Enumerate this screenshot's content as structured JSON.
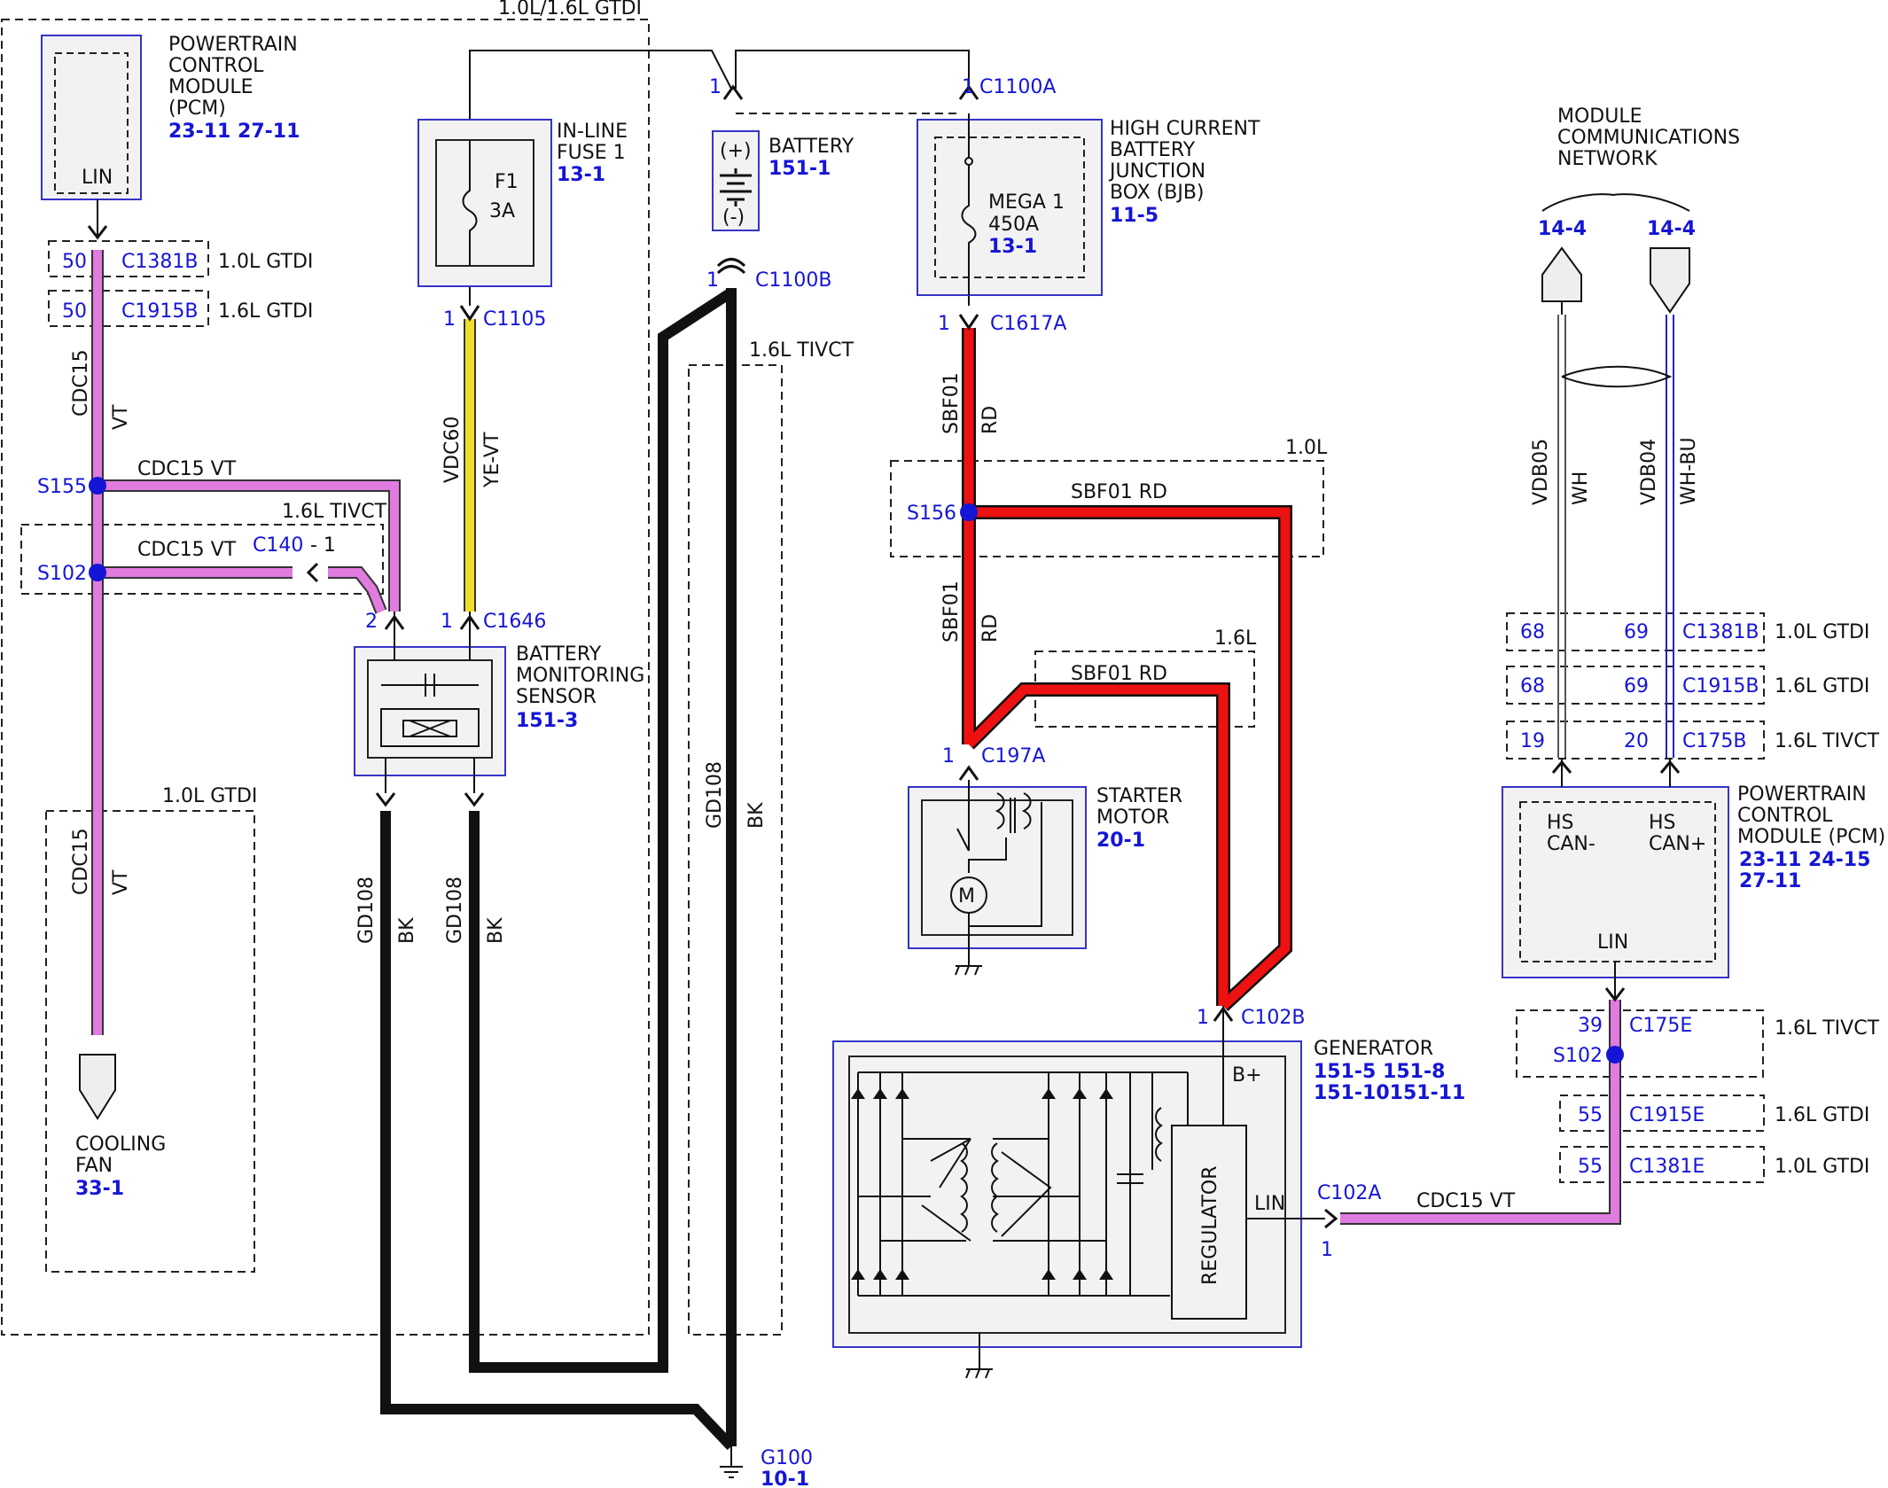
{
  "labels": {
    "gtdi_both": "1.0L/1.6L GTDI",
    "tivct": "1.6L TIVCT",
    "gtdi10": "1.0L GTDI",
    "gtdi16": "1.6L GTDI",
    "l10": "1.0L",
    "l16": "1.6L"
  },
  "pcm": {
    "l1": "POWERTRAIN",
    "l2": "CONTROL",
    "l3": "MODULE",
    "l4": "(PCM)",
    "ref": "23-11 27-11",
    "pin": "LIN"
  },
  "fuse": {
    "l1": "IN-LINE",
    "l2": "FUSE 1",
    "ref": "13-1",
    "name": "F1",
    "rating": "3A"
  },
  "battery": {
    "name": "BATTERY",
    "ref": "151-1",
    "plus": "(+)",
    "minus": "(-)"
  },
  "bjb": {
    "l1": "HIGH CURRENT",
    "l2": "BATTERY",
    "l3": "JUNCTION",
    "l4": "BOX (BJB)",
    "ref": "11-5",
    "fuse": "MEGA 1",
    "rating": "450A",
    "fuse_ref": "13-1"
  },
  "network": {
    "l1": "MODULE",
    "l2": "COMMUNICATIONS",
    "l3": "NETWORK",
    "ref_a": "14-4",
    "ref_b": "14-4"
  },
  "bms": {
    "l1": "BATTERY",
    "l2": "MONITORING",
    "l3": "SENSOR",
    "ref": "151-3"
  },
  "starter": {
    "l1": "STARTER",
    "l2": "MOTOR",
    "ref": "20-1"
  },
  "fan": {
    "l1": "COOLING",
    "l2": "FAN",
    "ref": "33-1"
  },
  "pcm2": {
    "l1": "POWERTRAIN",
    "l2": "CONTROL",
    "l3": "MODULE (PCM)",
    "ref1": "23-11 24-15",
    "ref2": "27-11",
    "can_lo1": "HS",
    "can_lo2": "CAN-",
    "can_hi1": "HS",
    "can_hi2": "CAN+",
    "pin": "LIN"
  },
  "generator": {
    "name": "GENERATOR",
    "ref1": "151-5 151-8",
    "ref2": "151-10151-11",
    "bplus": "B+",
    "regulator": "REGULATOR",
    "lin": "LIN"
  },
  "ground": {
    "name": "G100",
    "ref": "10-1"
  },
  "connectors": {
    "c1381b": "C1381B",
    "c1915b": "C1915B",
    "c1105": "C1105",
    "c1100a": "C1100A",
    "c1100b": "C1100B",
    "c1617a": "C1617A",
    "c1646": "C1646",
    "c140": "C140",
    "c197a": "C197A",
    "c102b": "C102B",
    "c102a": "C102A",
    "c175b": "C175B",
    "c175e": "C175E",
    "c1915e": "C1915E",
    "c1381e": "C1381E"
  },
  "pins": {
    "p1": "1",
    "p2": "2",
    "p19": "19",
    "p20": "20",
    "p39": "39",
    "p50": "50",
    "p55": "55",
    "p68": "68",
    "p69": "69",
    "dash1": "- 1"
  },
  "splices": {
    "s155": "S155",
    "s102": "S102",
    "s156": "S156"
  },
  "wires": {
    "cdc15": "CDC15",
    "vt": "VT",
    "cdc15_vt": "CDC15 VT",
    "vdc60": "VDC60",
    "ye_vt": "YE-VT",
    "gd108": "GD108",
    "bk": "BK",
    "sbf01": "SBF01",
    "rd": "RD",
    "sbf01_rd": "SBF01  RD",
    "vdb05": "VDB05",
    "wh": "WH",
    "vdb04": "VDB04",
    "wh_bu": "WH-BU"
  },
  "colors": {
    "violet": "#e07be0",
    "red": "#ee1111",
    "yellow": "#f0dc2a",
    "black": "#111111",
    "blue_text": "#1515d6"
  }
}
